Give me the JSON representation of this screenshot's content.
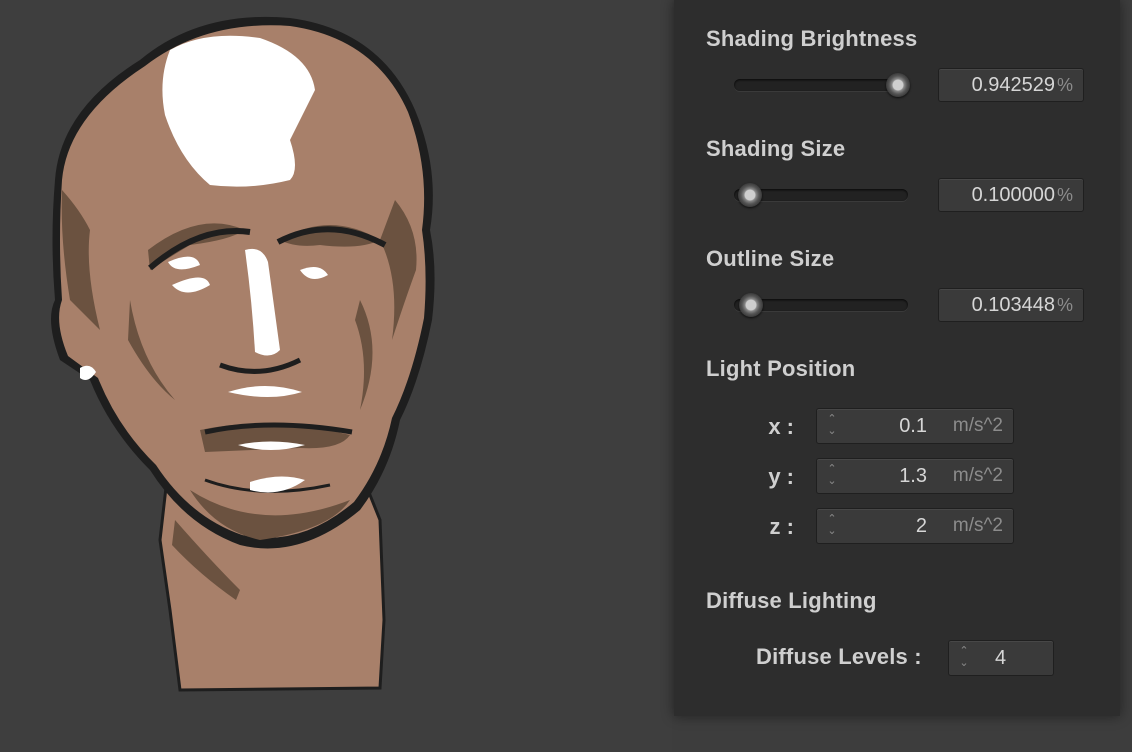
{
  "viewport": {
    "model": "bust-head",
    "colors": {
      "skin": "#a8806a",
      "shadow": "#6b5240",
      "outline": "#1e1e1e",
      "highlight": "#ffffff",
      "background": "#3e3e3e"
    }
  },
  "panel": {
    "shading_brightness": {
      "label": "Shading Brightness",
      "value": "0.942529",
      "unit": "%",
      "level": 0.94
    },
    "shading_size": {
      "label": "Shading Size",
      "value": "0.100000",
      "unit": "%",
      "level": 0.1
    },
    "outline_size": {
      "label": "Outline Size",
      "value": "0.103448",
      "unit": "%",
      "level": 0.1
    },
    "light_position": {
      "label": "Light Position",
      "x": {
        "label": "x :",
        "value": "0.1",
        "unit": "m/s^2"
      },
      "y": {
        "label": "y :",
        "value": "1.3",
        "unit": "m/s^2"
      },
      "z": {
        "label": "z :",
        "value": "2",
        "unit": "m/s^2"
      }
    },
    "diffuse_lighting": {
      "label": "Diffuse Lighting",
      "levels_label": "Diffuse Levels :",
      "levels_value": "4"
    }
  }
}
